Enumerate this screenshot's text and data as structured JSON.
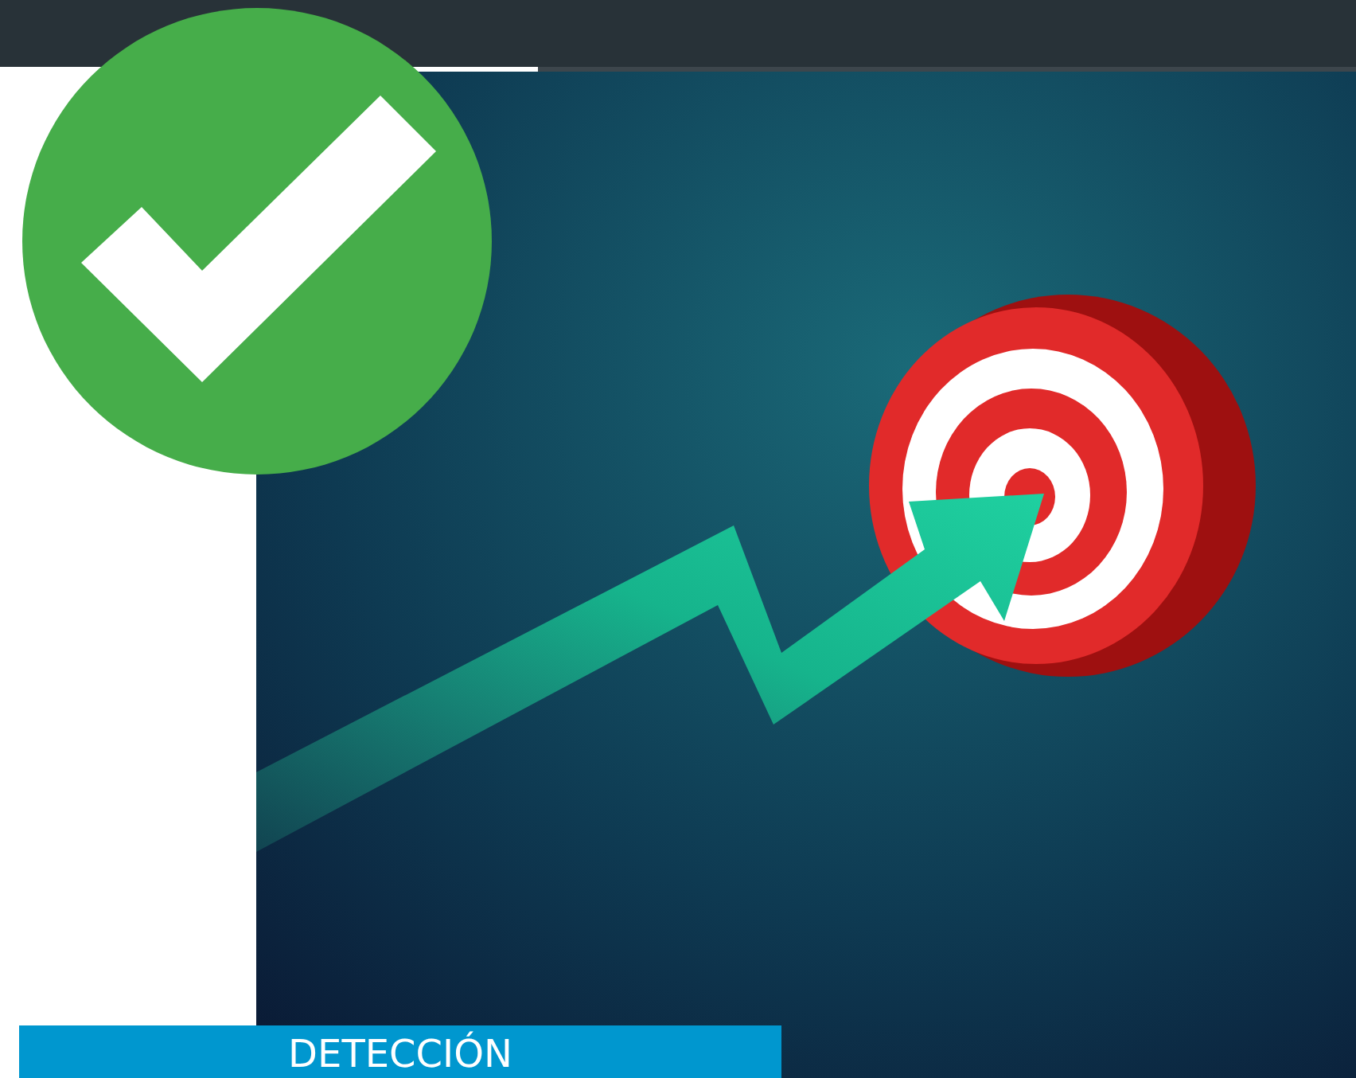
{
  "banner": {
    "label": "DETECCIÓN"
  }
}
